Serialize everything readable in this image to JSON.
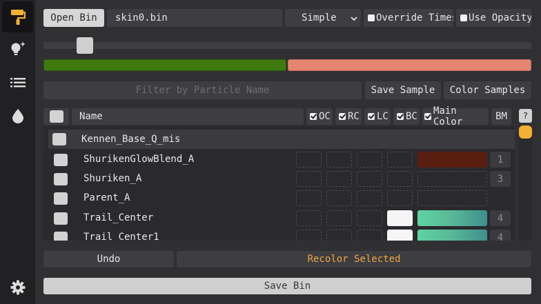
{
  "sidebar": {
    "items": [
      {
        "icon": "paint-roller-icon",
        "active": true
      },
      {
        "icon": "lightbulb-sparkle-icon",
        "active": false
      },
      {
        "icon": "list-icon",
        "active": false
      },
      {
        "icon": "droplet-icon",
        "active": false
      }
    ],
    "settings_icon": "gear-icon"
  },
  "toolbar": {
    "open_bin_label": "Open Bin",
    "file_name": "skin0.bin",
    "mode_selected": "Simple",
    "override_times_label": "Override Times",
    "use_opacity_label": "Use Opacity",
    "override_times_checked": false,
    "use_opacity_checked": false
  },
  "slider": {
    "value_fraction": 0.07
  },
  "gradient": {
    "colors": [
      "#3e7a10",
      "#e68672"
    ]
  },
  "filter": {
    "placeholder": "Filter by Particle Name",
    "save_sample_label": "Save Sample",
    "color_samples_label": "Color Samples"
  },
  "columns": {
    "name": "Name",
    "oc": "OC",
    "rc": "RC",
    "lc": "LC",
    "bc": "BC",
    "main_color": "Main Color",
    "bm": "BM",
    "help": "?"
  },
  "particles": {
    "group_name": "Kennen_Base_Q_mis",
    "rows": [
      {
        "name": "ShurikenGlowBlend_A",
        "bm": "1",
        "color": "dark"
      },
      {
        "name": "Shuriken_A",
        "bm": "3",
        "color": "empty"
      },
      {
        "name": "Parent_A",
        "bm": "",
        "color": "empty"
      },
      {
        "name": "Trail_Center",
        "bm": "4",
        "color": "gradient"
      },
      {
        "name": "Trail_Center1",
        "bm": "4",
        "color": "gradient"
      }
    ]
  },
  "actions": {
    "undo_label": "Undo",
    "recolor_label": "Recolor Selected",
    "save_bin_label": "Save Bin"
  },
  "colors": {
    "accent": "#f2b134",
    "recolor_text": "#f0a63a",
    "sidebar_bg": "#212124",
    "panel_bg": "#303033"
  }
}
